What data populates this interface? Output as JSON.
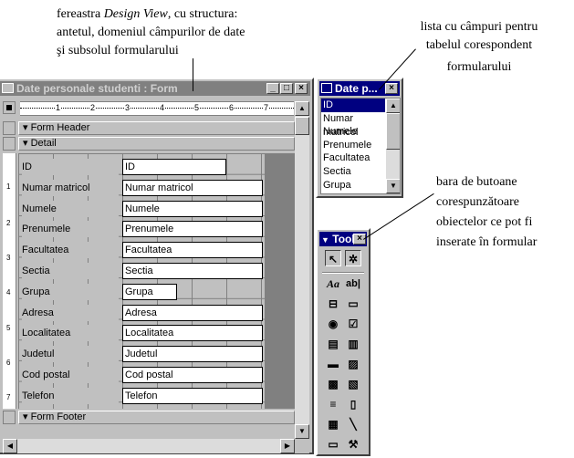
{
  "annotations": {
    "top_line1_a": "fereastra ",
    "top_line1_italic": "Design View",
    "top_line1_b": ", cu structura:",
    "top_line2": "antetul, domeniul câmpurilor de date",
    "top_line3": "şi subsolul formularului",
    "right_top_line1": "lista cu câmpuri pentru",
    "right_top_line2": "tabelul corespondent",
    "right_top_line3": "formularului",
    "right_mid_line1": "bara de butoane",
    "right_mid_line2": "corespunzătoare",
    "right_mid_line3": "obiectelor ce pot fi",
    "right_mid_line4": "inserate în formular"
  },
  "form_window": {
    "title": "Date personale studenti : Form",
    "ruler_marks": [
      "1",
      "2",
      "3",
      "4",
      "5",
      "6",
      "7"
    ],
    "sections": {
      "header": "Form Header",
      "detail": "Detail",
      "footer": "Form Footer"
    },
    "vruler_marks": [
      "1",
      "2",
      "3",
      "4",
      "5",
      "6",
      "7"
    ],
    "rows": [
      {
        "label": "ID",
        "field": "ID"
      },
      {
        "label": "Numar matricol",
        "field": "Numar matricol"
      },
      {
        "label": "Numele",
        "field": "Numele"
      },
      {
        "label": "Prenumele",
        "field": "Prenumele"
      },
      {
        "label": "Facultatea",
        "field": "Facultatea"
      },
      {
        "label": "Sectia",
        "field": "Sectia"
      },
      {
        "label": "Grupa",
        "field": "Grupa"
      },
      {
        "label": "Adresa",
        "field": "Adresa"
      },
      {
        "label": "Localitatea",
        "field": "Localitatea"
      },
      {
        "label": "Judetul",
        "field": "Judetul"
      },
      {
        "label": "Cod postal",
        "field": "Cod postal"
      },
      {
        "label": "Telefon",
        "field": "Telefon"
      }
    ]
  },
  "field_list": {
    "title": "Date p...",
    "items": [
      "ID",
      "Numar matricol",
      "Numele",
      "Prenumele",
      "Facultatea",
      "Sectia",
      "Grupa"
    ],
    "selected": "ID"
  },
  "toolbox": {
    "title": "Toolb",
    "text_tool": "Aa",
    "textbox_tool": "ab|"
  },
  "colors": {
    "title_active": "#000080",
    "title_inactive": "#808080",
    "face": "#c0c0c0"
  }
}
